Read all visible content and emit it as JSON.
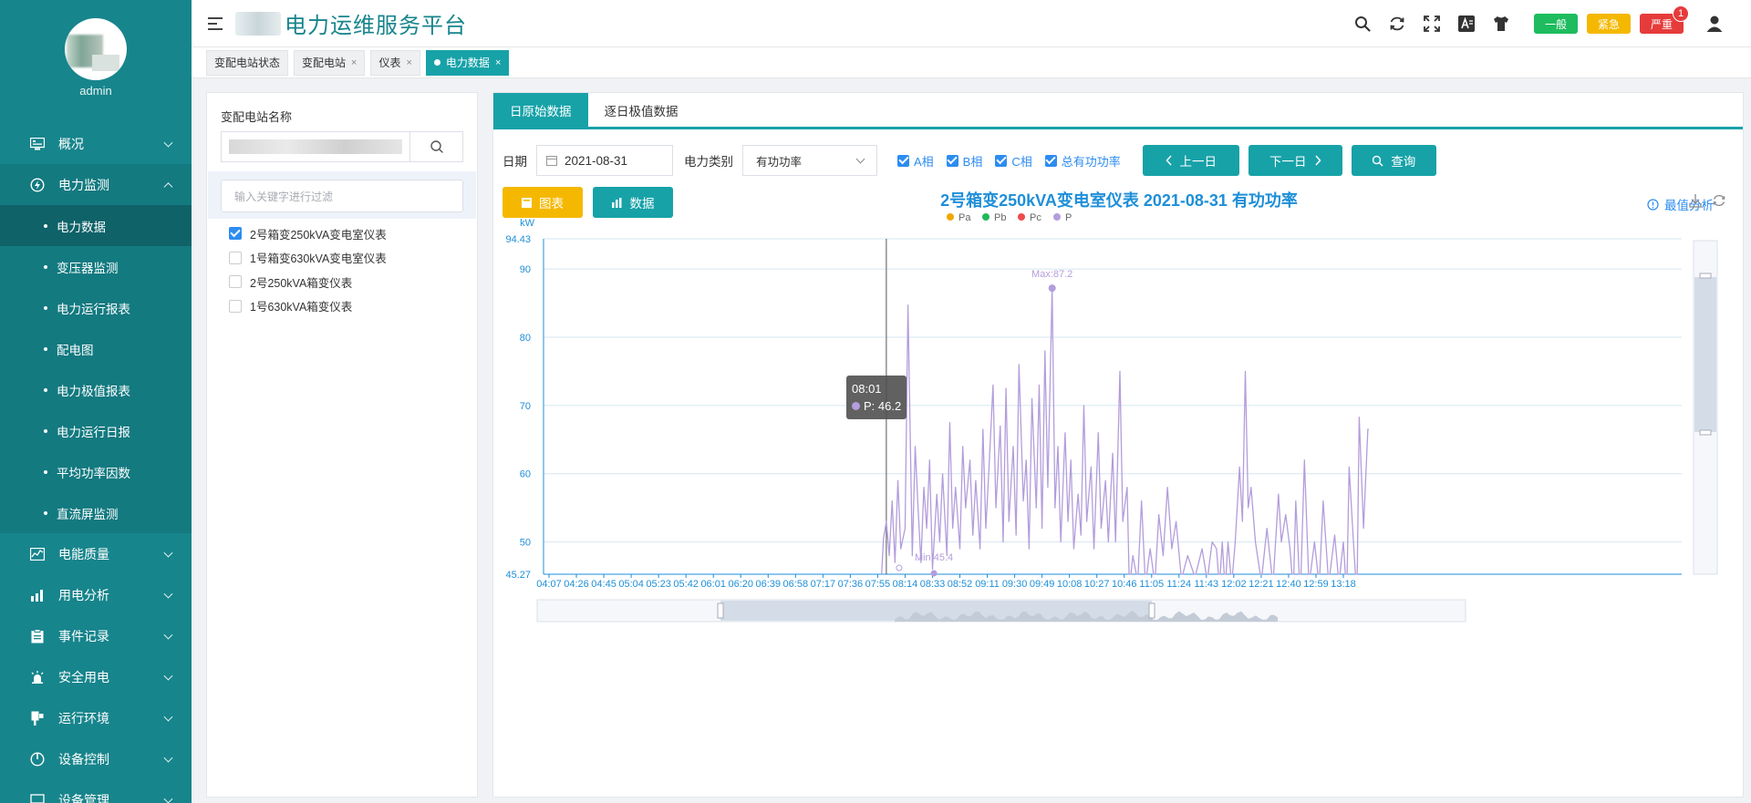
{
  "app": {
    "title": "电力运维服务平台",
    "user": "admin"
  },
  "sidebar": {
    "items": [
      {
        "label": "概况",
        "icon": "monitor-icon",
        "expanded": false
      },
      {
        "label": "电力监测",
        "icon": "power-icon",
        "expanded": true,
        "children": [
          "电力数据",
          "变压器监测",
          "电力运行报表",
          "配电图",
          "电力极值报表",
          "电力运行日报",
          "平均功率因数",
          "直流屏监测"
        ]
      },
      {
        "label": "电能质量",
        "icon": "quality-icon",
        "expanded": false
      },
      {
        "label": "用电分析",
        "icon": "analysis-icon",
        "expanded": false
      },
      {
        "label": "事件记录",
        "icon": "event-icon",
        "expanded": false
      },
      {
        "label": "安全用电",
        "icon": "alarm-icon",
        "expanded": false
      },
      {
        "label": "运行环境",
        "icon": "environment-icon",
        "expanded": false
      },
      {
        "label": "设备控制",
        "icon": "control-icon",
        "expanded": false
      },
      {
        "label": "设备管理",
        "icon": "device-icon",
        "expanded": false
      }
    ],
    "active_sub": "电力数据"
  },
  "header": {
    "alerts": [
      {
        "label": "一般",
        "color": "#1ebc5e"
      },
      {
        "label": "紧急",
        "color": "#f5b800"
      },
      {
        "label": "严重",
        "color": "#e63b3b",
        "badge": "1"
      }
    ]
  },
  "tabs": [
    {
      "label": "变配电站状态",
      "closable": false,
      "active": false
    },
    {
      "label": "变配电站",
      "closable": true,
      "active": false
    },
    {
      "label": "仪表",
      "closable": true,
      "active": false
    },
    {
      "label": "电力数据",
      "closable": true,
      "active": true
    }
  ],
  "left_panel": {
    "title": "变配电站名称",
    "filter_placeholder": "输入关键字进行过滤",
    "meters": [
      {
        "label": "2号箱变250kVA变电室仪表",
        "checked": true
      },
      {
        "label": "1号箱变630kVA变电室仪表",
        "checked": false
      },
      {
        "label": "2号250kVA箱变仪表",
        "checked": false
      },
      {
        "label": "1号630kVA箱变仪表",
        "checked": false
      }
    ]
  },
  "main": {
    "tabs": [
      "日原始数据",
      "逐日极值数据"
    ],
    "date_label": "日期",
    "date_value": "2021-08-31",
    "type_label": "电力类别",
    "type_value": "有功功率",
    "checks": [
      {
        "label": "A相",
        "checked": true
      },
      {
        "label": "B相",
        "checked": true
      },
      {
        "label": "C相",
        "checked": true
      },
      {
        "label": "总有功功率",
        "checked": true
      }
    ],
    "prev_label": "上一日",
    "next_label": "下一日",
    "query_label": "查询",
    "chart_btn": "图表",
    "data_btn": "数据",
    "extreme_label": "最值分析"
  },
  "chart_data": {
    "type": "line",
    "title": "2号箱变250kVA变电室仪表  2021-08-31  有功功率",
    "ylabel": "kW",
    "ylim": [
      45.27,
      94.43
    ],
    "yticks": [
      50,
      60,
      70,
      80,
      90
    ],
    "grid": true,
    "legend": [
      {
        "name": "Pa",
        "color": "#f0a800"
      },
      {
        "name": "Pb",
        "color": "#22b85a"
      },
      {
        "name": "Pc",
        "color": "#ef4b4b"
      },
      {
        "name": "P",
        "color": "#b39ddb"
      }
    ],
    "x_ticks": [
      "04:07",
      "04:26",
      "04:45",
      "05:04",
      "05:23",
      "05:42",
      "06:01",
      "06:20",
      "06:39",
      "06:58",
      "07:17",
      "07:36",
      "07:55",
      "08:14",
      "08:33",
      "08:52",
      "09:11",
      "09:30",
      "09:49",
      "10:08",
      "10:27",
      "10:46",
      "11:05",
      "11:24",
      "11:43",
      "12:02",
      "12:21",
      "12:40",
      "12:59",
      "13:18"
    ],
    "max_label": "Max:87.2",
    "min_label": "Min:45.4",
    "max_point": {
      "x": "09:56",
      "y": 87.2
    },
    "min_point": {
      "x": "08:34",
      "y": 45.4
    },
    "tooltip": {
      "time": "08:01",
      "series": "P",
      "value": 46.2,
      "text": "P: 46.2"
    },
    "series": [
      {
        "name": "P",
        "peaks": [
          [
            "07:59",
            50.5
          ],
          [
            "08:01",
            53
          ],
          [
            "08:03",
            48
          ],
          [
            "08:05",
            56
          ],
          [
            "08:07",
            47
          ],
          [
            "08:09",
            59
          ],
          [
            "08:11",
            49
          ],
          [
            "08:14",
            52
          ],
          [
            "08:16",
            84.7
          ],
          [
            "08:19",
            48
          ],
          [
            "08:21",
            64
          ],
          [
            "08:23",
            55
          ],
          [
            "08:25",
            47
          ],
          [
            "08:27",
            58
          ],
          [
            "08:29",
            52
          ],
          [
            "08:31",
            62
          ],
          [
            "08:33",
            46
          ],
          [
            "08:36",
            57
          ],
          [
            "08:38",
            50
          ],
          [
            "08:40",
            60
          ],
          [
            "08:43",
            48
          ],
          [
            "08:45",
            67.5
          ],
          [
            "08:47",
            52
          ],
          [
            "08:49",
            58
          ],
          [
            "08:52",
            49
          ],
          [
            "08:54",
            64
          ],
          [
            "08:56",
            55
          ],
          [
            "08:59",
            62
          ],
          [
            "09:01",
            51
          ],
          [
            "09:03",
            59
          ],
          [
            "09:06",
            49
          ],
          [
            "09:08",
            66.5
          ],
          [
            "09:10",
            52
          ],
          [
            "09:12",
            60
          ],
          [
            "09:15",
            73
          ],
          [
            "09:17",
            55
          ],
          [
            "09:20",
            67
          ],
          [
            "09:22",
            50
          ],
          [
            "09:24",
            72.5
          ],
          [
            "09:26",
            53
          ],
          [
            "09:29",
            64
          ],
          [
            "09:31",
            51
          ],
          [
            "09:33",
            76
          ],
          [
            "09:36",
            56
          ],
          [
            "09:38",
            62
          ],
          [
            "09:40",
            49
          ],
          [
            "09:42",
            71
          ],
          [
            "09:45",
            55
          ],
          [
            "09:47",
            73
          ],
          [
            "09:49",
            52
          ],
          [
            "09:51",
            78
          ],
          [
            "09:53",
            58
          ],
          [
            "09:56",
            87.2
          ],
          [
            "09:58",
            55
          ],
          [
            "10:00",
            64
          ],
          [
            "10:02",
            50
          ],
          [
            "10:05",
            66
          ],
          [
            "10:07",
            53
          ],
          [
            "10:09",
            62
          ],
          [
            "10:11",
            49
          ],
          [
            "10:14",
            57
          ],
          [
            "10:16",
            51
          ],
          [
            "10:18",
            70
          ],
          [
            "10:20",
            53
          ],
          [
            "10:23",
            61
          ],
          [
            "10:25",
            49
          ],
          [
            "10:28",
            66
          ],
          [
            "10:30",
            52
          ],
          [
            "10:33",
            59
          ],
          [
            "10:35",
            50
          ],
          [
            "10:38",
            63
          ],
          [
            "10:40",
            50
          ],
          [
            "10:43",
            75
          ],
          [
            "10:45",
            53
          ],
          [
            "10:48",
            58
          ],
          [
            "10:52",
            48
          ],
          [
            "10:58",
            56
          ],
          [
            "11:04",
            49
          ],
          [
            "11:10",
            54
          ],
          [
            "11:13",
            48
          ],
          [
            "11:16",
            58
          ],
          [
            "11:19",
            49
          ],
          [
            "11:22",
            53
          ],
          [
            "11:30",
            48
          ],
          [
            "11:40",
            49
          ],
          [
            "11:47",
            50
          ],
          [
            "11:50",
            49
          ],
          [
            "11:54",
            50
          ],
          [
            "11:58",
            50
          ],
          [
            "12:03",
            50
          ],
          [
            "12:06",
            61
          ],
          [
            "12:08",
            53
          ],
          [
            "12:10",
            75
          ],
          [
            "12:12",
            55
          ],
          [
            "12:14",
            58
          ],
          [
            "12:17",
            50
          ],
          [
            "12:25",
            52
          ],
          [
            "12:33",
            57
          ],
          [
            "12:35",
            50
          ],
          [
            "12:38",
            54
          ],
          [
            "12:41",
            49
          ],
          [
            "12:45",
            56
          ],
          [
            "12:51",
            62
          ],
          [
            "12:58",
            50
          ],
          [
            "13:04",
            56
          ],
          [
            "13:12",
            51
          ],
          [
            "13:18",
            50
          ],
          [
            "13:22",
            61
          ],
          [
            "13:25",
            50
          ],
          [
            "13:29",
            68.3
          ],
          [
            "13:32",
            52
          ],
          [
            "13:35",
            66.5
          ]
        ]
      }
    ]
  }
}
